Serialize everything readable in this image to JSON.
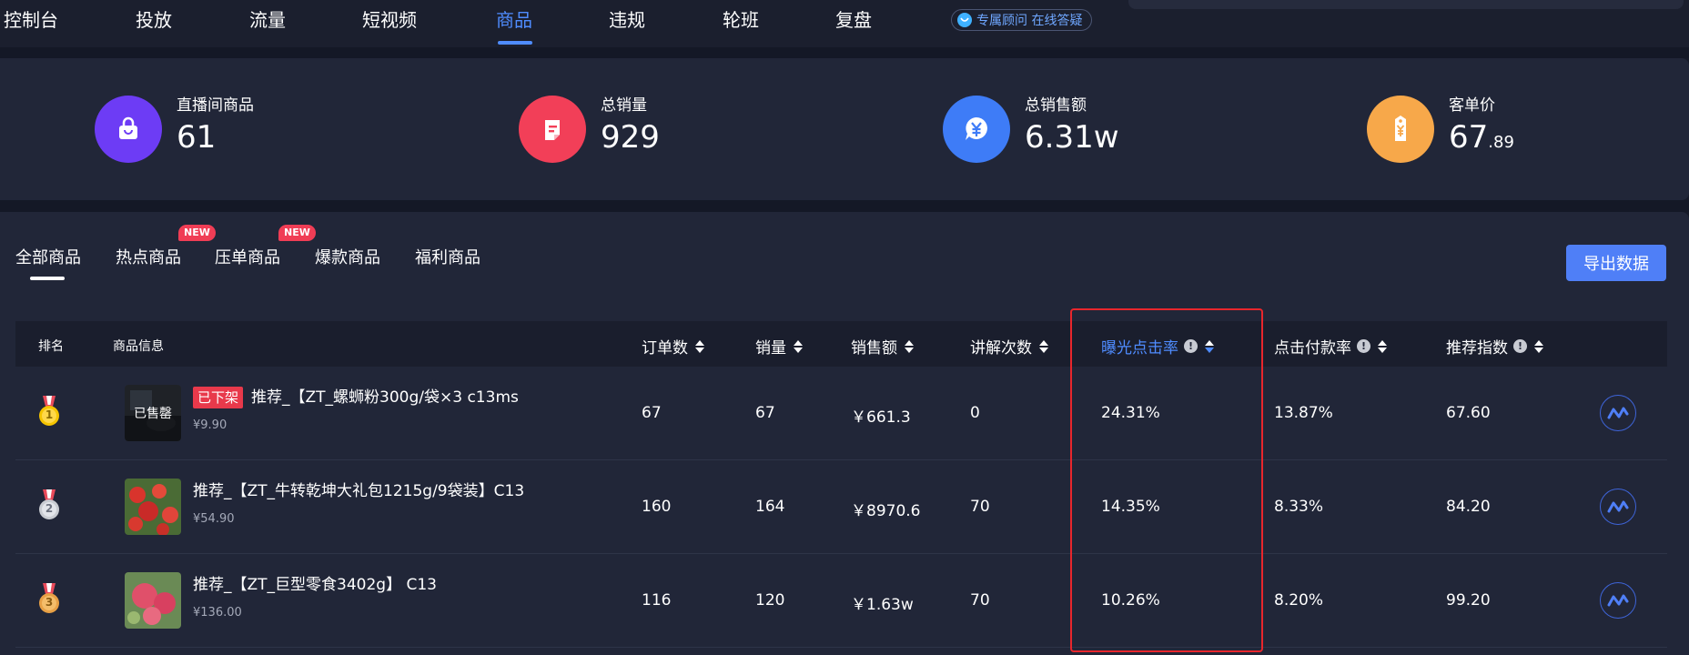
{
  "nav": {
    "items": [
      "控制台",
      "投放",
      "流量",
      "短视频",
      "商品",
      "违规",
      "轮班",
      "复盘"
    ],
    "active_index": 4,
    "consult_label": "专属顾问 在线答疑"
  },
  "stats": [
    {
      "label": "直播间商品",
      "value": "61",
      "decimal": "",
      "icon": "shopping-bag-icon",
      "color": "#6d3cf5"
    },
    {
      "label": "总销量",
      "value": "929",
      "decimal": "",
      "icon": "document-icon",
      "color": "#f23f58"
    },
    {
      "label": "总销售额",
      "value": "6.31w",
      "decimal": "",
      "icon": "yuan-icon",
      "color": "#3e7cf7"
    },
    {
      "label": "客单价",
      "value": "67",
      "decimal": ".89",
      "icon": "price-tag-icon",
      "color": "#f7a84a"
    }
  ],
  "tabs": {
    "items": [
      {
        "label": "全部商品",
        "badge": ""
      },
      {
        "label": "热点商品",
        "badge": "NEW"
      },
      {
        "label": "压单商品",
        "badge": "NEW"
      },
      {
        "label": "爆款商品",
        "badge": ""
      },
      {
        "label": "福利商品",
        "badge": ""
      }
    ],
    "active_index": 0,
    "export_label": "导出数据"
  },
  "table": {
    "headers": {
      "rank": "排名",
      "info": "商品信息",
      "orders": "订单数",
      "sales": "销量",
      "revenue": "销售额",
      "explains": "讲解次数",
      "ctr": "曝光点击率",
      "pay_rate": "点击付款率",
      "score": "推荐指数"
    },
    "rows": [
      {
        "rank": "1",
        "status": "已下架",
        "overlay": "已售罄",
        "name": "推荐_【ZT_螺蛳粉300g/袋×3 c13ms",
        "price": "¥9.90",
        "orders": "67",
        "sales": "67",
        "revenue": "￥661.3",
        "explains": "0",
        "ctr": "24.31%",
        "pay_rate": "13.87%",
        "score": "67.60"
      },
      {
        "rank": "2",
        "status": "",
        "overlay": "",
        "name": "推荐_【ZT_牛转乾坤大礼包1215g/9袋装】C13",
        "price": "¥54.90",
        "orders": "160",
        "sales": "164",
        "revenue": "￥8970.6",
        "explains": "70",
        "ctr": "14.35%",
        "pay_rate": "8.33%",
        "score": "84.20"
      },
      {
        "rank": "3",
        "status": "",
        "overlay": "",
        "name": "推荐_【ZT_巨型零食3402g】 C13",
        "price": "¥136.00",
        "orders": "116",
        "sales": "120",
        "revenue": "￥1.63w",
        "explains": "70",
        "ctr": "10.26%",
        "pay_rate": "8.20%",
        "score": "99.20"
      }
    ]
  },
  "colors": {
    "accent": "#4f8cff",
    "highlight_box": "#e8262c",
    "medal_gold": "#f5c400",
    "medal_silver": "#c9ccd2",
    "medal_bronze": "#e8a045"
  }
}
